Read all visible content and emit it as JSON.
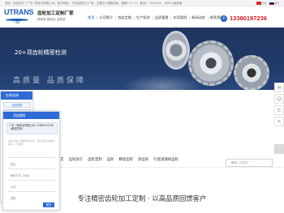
{
  "topbar": {
    "notice": "您好，欢迎访问「广东一翔传动有限公司」官方网站！ 专业齿轮加工厂家，主要牛小模数齿轮，模数0.3~15，直径0~1000mm，DIN5-9级精度",
    "lang_cn": "CN",
    "lang_en": "EN"
  },
  "header": {
    "logo_text": "UTRANS",
    "logo_sub": "一翔",
    "company": "齿轮加工定制厂家",
    "slogan": "科研富  精品实  品质变",
    "nav": [
      "首页",
      "公司简介",
      "齿轮定制",
      "生产检测",
      "品质管理",
      "应用案例",
      "新闻动态",
      "联系我们"
    ],
    "phone": "13380197236"
  },
  "banner": {
    "line1": "20+项齿轮精密检测",
    "line2": "高质量  品质保障"
  },
  "kefu": {
    "title": "在线咨询",
    "items": [
      "在线咨询",
      "联系电话",
      "联系我们"
    ]
  },
  "chat": {
    "title": "添加客服",
    "message": "广东一翔传动有限公司 13380197236（微信同号）",
    "placeholder": "请您在输入需要写的文字，我们会及时给你联系（已添加）",
    "fields": [
      "姓名",
      "联系方式（必填）",
      "公司",
      "类型"
    ],
    "submit": "提交"
  },
  "crumb": [
    "齿轮加工",
    "齿轮加工",
    "齿轮定制",
    "齿轮",
    "精密齿轮",
    "斜齿轮",
    "行星减速机齿轮"
  ],
  "search": {
    "placeholder": "请输入关键字"
  },
  "slogan2": "专注精密齿轮加工定制 · 以高品质回馈客户",
  "colors": {
    "brand": "#1a5fb4",
    "phone": "#d71920",
    "banner": "#1f3560",
    "chat": "#2f6bd7"
  }
}
